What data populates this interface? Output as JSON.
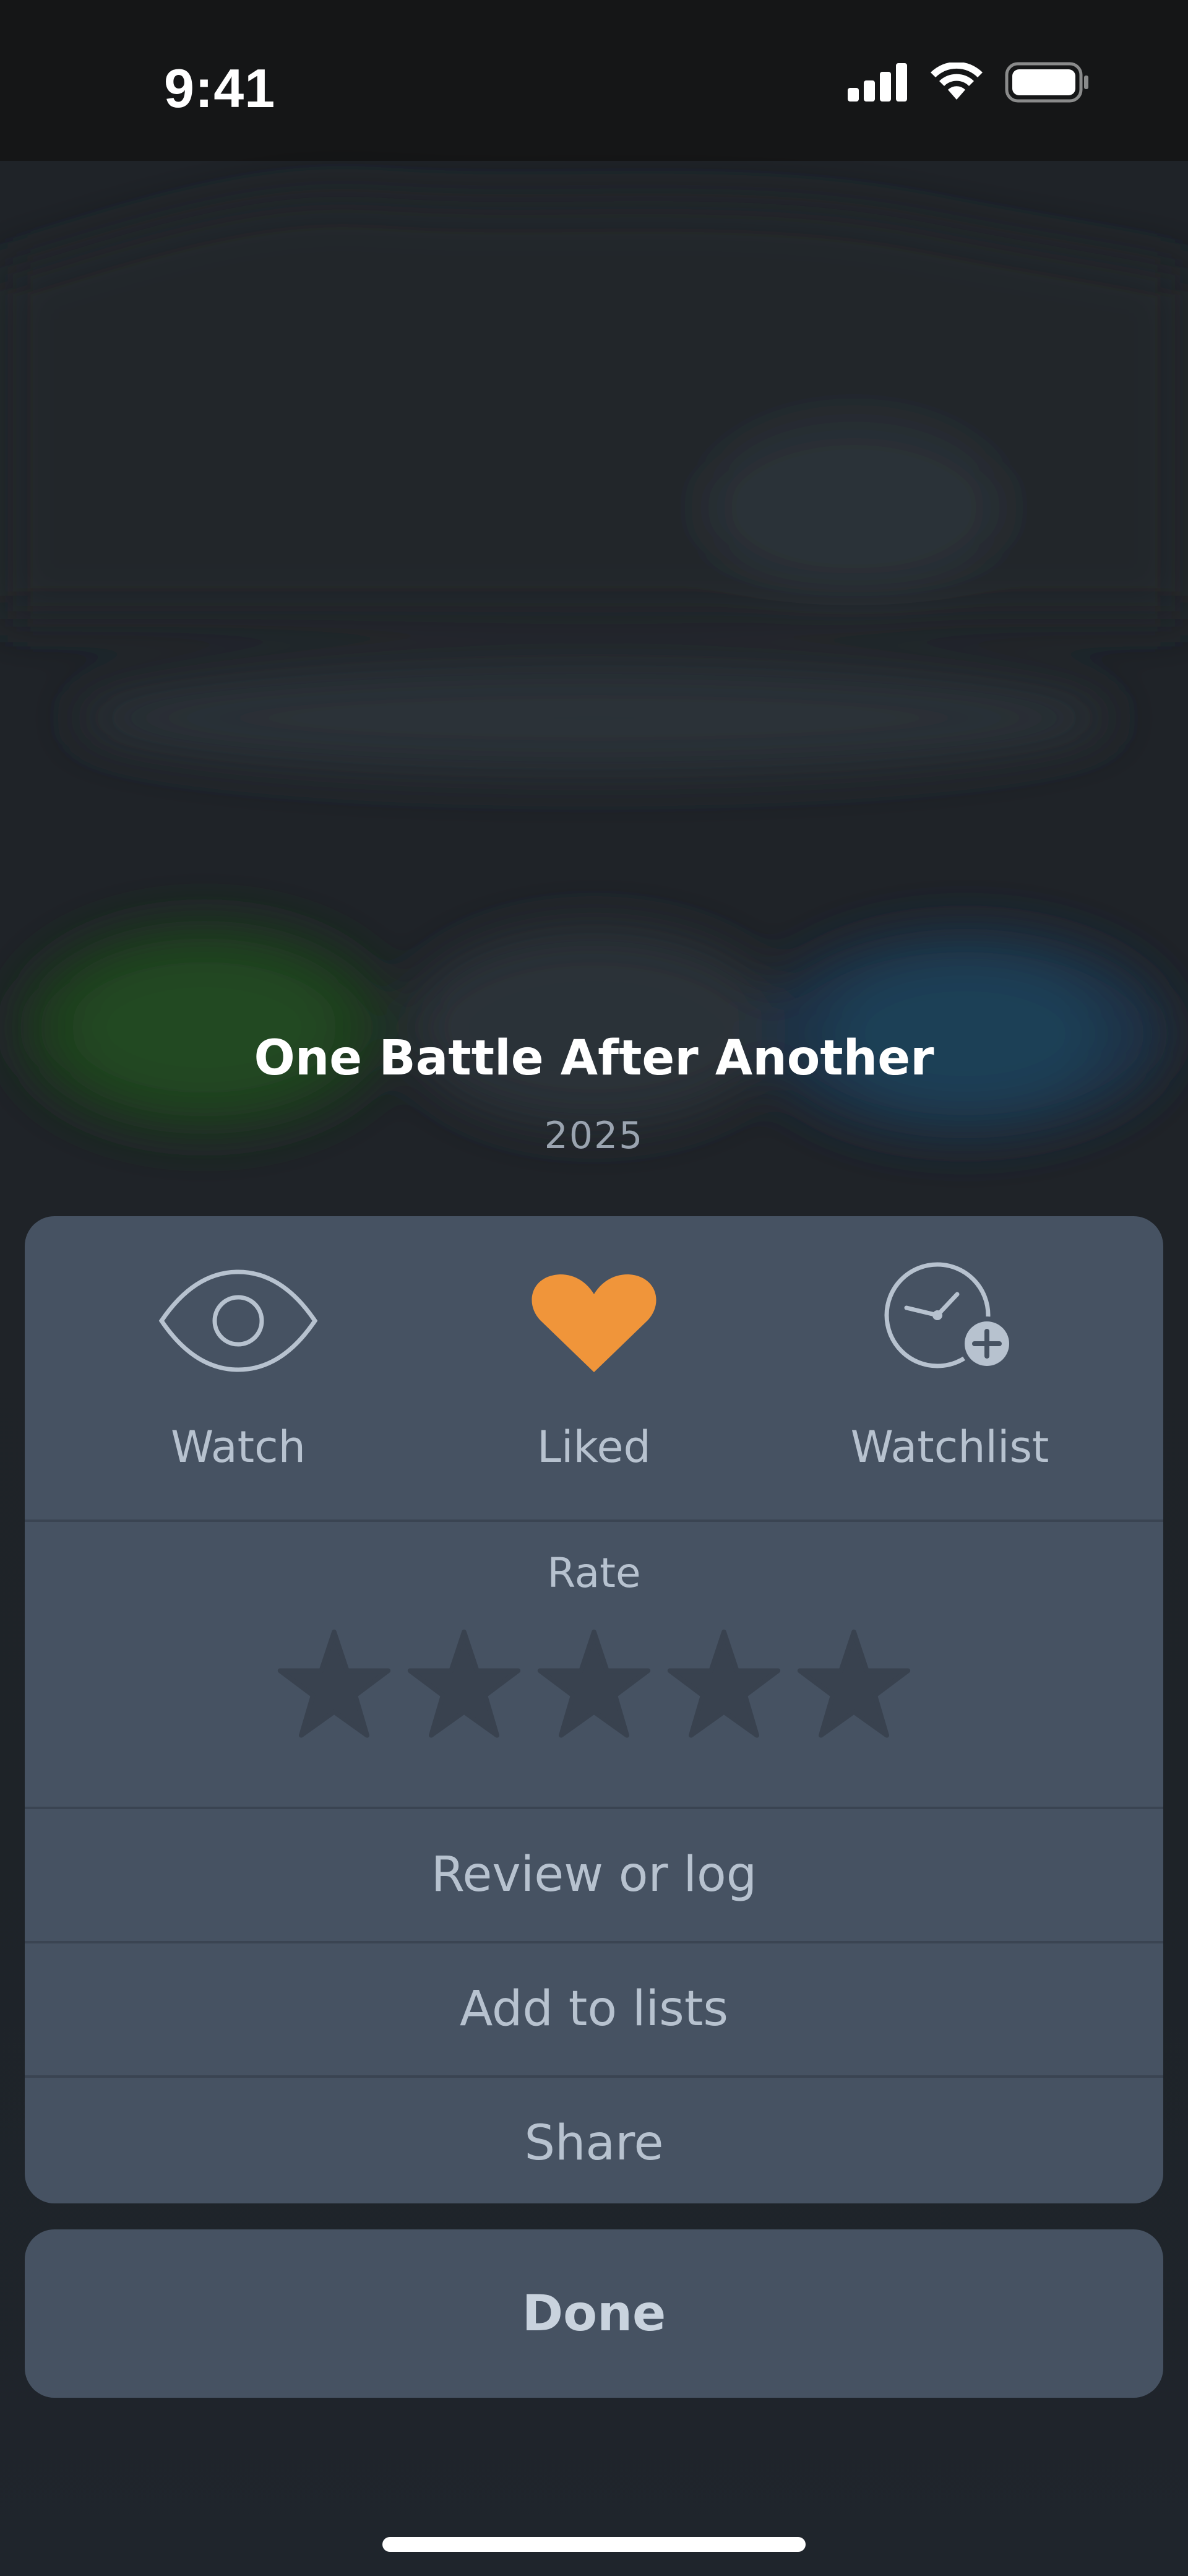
{
  "status_bar": {
    "time": "9:41",
    "icons": [
      "cellular-signal-icon",
      "wifi-icon",
      "battery-icon"
    ]
  },
  "movie": {
    "title": "One Battle After Another",
    "year": "2025"
  },
  "actions": {
    "watch": {
      "label": "Watch",
      "icon": "eye-icon"
    },
    "liked": {
      "label": "Liked",
      "icon": "heart-icon",
      "color": "#f0953a"
    },
    "watchlist": {
      "label": "Watchlist",
      "icon": "clock-plus-icon"
    }
  },
  "rating": {
    "label": "Rate",
    "max_stars": 5,
    "current_rating": 0
  },
  "menu": {
    "review_label": "Review or log",
    "add_lists_label": "Add to lists",
    "share_label": "Share"
  },
  "done_label": "Done",
  "colors": {
    "sheet_bg": "#465262",
    "divider": "#3a4452",
    "text_muted": "#b7c2cf",
    "accent_orange": "#f0953a",
    "star_empty": "#39424f"
  }
}
